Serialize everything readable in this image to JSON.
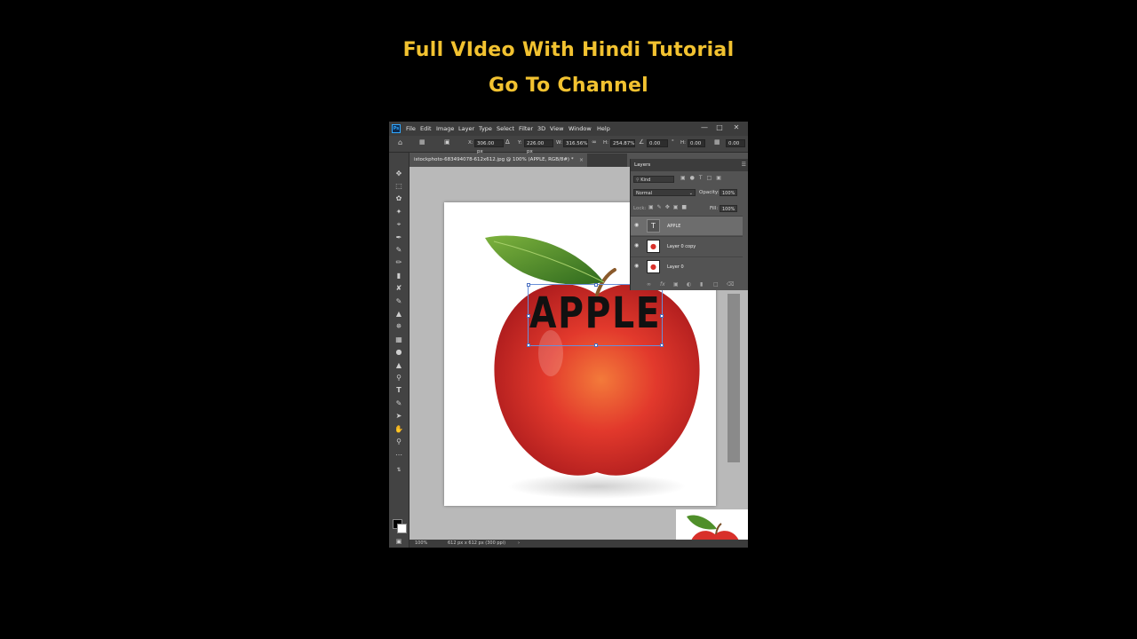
{
  "banner": {
    "line1": "Full VIdeo With Hindi Tutorial",
    "line2": "Go To Channel"
  },
  "app": {
    "logo": "Ps",
    "menu": [
      "File",
      "Edit",
      "Image",
      "Layer",
      "Type",
      "Select",
      "Filter",
      "3D",
      "View",
      "Window",
      "Help"
    ],
    "window_controls": [
      "—",
      "□",
      "✕"
    ]
  },
  "options": {
    "x_label": "X:",
    "x_value": "306.00 px",
    "y_label": "Y:",
    "y_value": "226.00 px",
    "w_label": "W:",
    "w_value": "316.56%",
    "h_label": "H:",
    "h_value": "254.87%",
    "angle_value": "0.00",
    "h_skew_label": "H:",
    "h_skew_value": "0.00",
    "v_skew_value": "0.00"
  },
  "document": {
    "tab_title": "istockphoto-683494078-612x612.jpg @ 100% (APPLE, RGB/8#) *",
    "close": "×",
    "canvas_text": "APPLE"
  },
  "status": {
    "zoom": "100%",
    "doc_info": "612 px x 612 px (300 ppi)"
  },
  "layers_panel": {
    "title": "Layers",
    "kind_placeholder": "Kind",
    "blend_mode": "Normal",
    "opacity_label": "Opacity:",
    "opacity_value": "100%",
    "lock_label": "Lock:",
    "fill_label": "Fill:",
    "fill_value": "100%",
    "layers": [
      {
        "name": "APPLE",
        "type": "text",
        "selected": true
      },
      {
        "name": "Layer 0 copy",
        "type": "image",
        "selected": false
      },
      {
        "name": "Layer 0",
        "type": "image",
        "selected": false
      }
    ],
    "footer_icons": [
      "link-icon",
      "fx-icon",
      "mask-icon",
      "adjustment-icon",
      "folder-icon",
      "new-layer-icon",
      "trash-icon"
    ]
  },
  "tools": [
    "move-icon",
    "marquee-icon",
    "lasso-icon",
    "magic-wand-icon",
    "crop-icon",
    "eyedropper-icon",
    "healing-icon",
    "brush-icon",
    "stamp-icon",
    "history-brush-icon",
    "eraser-icon",
    "gradient-icon",
    "blur-icon",
    "dodge-icon",
    "pen-icon",
    "type-icon",
    "path-select-icon",
    "shape-icon",
    "hand-icon",
    "zoom-icon",
    "more-icon"
  ],
  "colors": {
    "accent": "#f2c230",
    "ps_blue": "#31a8ff",
    "apple_red": "#d8302a",
    "leaf_green": "#4f8f2a"
  }
}
